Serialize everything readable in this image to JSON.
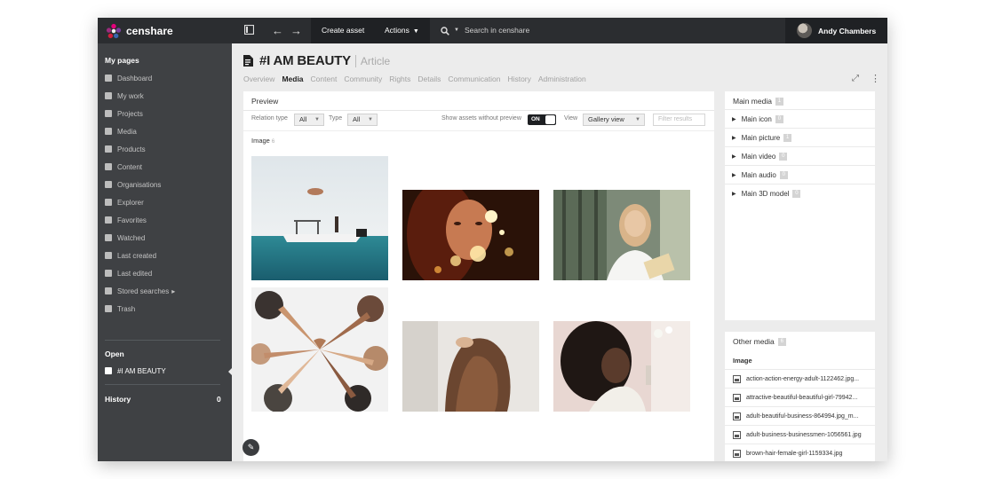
{
  "brand": {
    "name": "censhare"
  },
  "topbar": {
    "create_asset": "Create asset",
    "actions": "Actions",
    "search_placeholder": "Search in censhare",
    "user_name": "Andy Chambers"
  },
  "sidebar": {
    "my_pages_heading": "My pages",
    "items": [
      {
        "label": "Dashboard",
        "icon": "home-icon"
      },
      {
        "label": "My work",
        "icon": "inbox-icon"
      },
      {
        "label": "Projects",
        "icon": "projects-icon"
      },
      {
        "label": "Media",
        "icon": "image-icon"
      },
      {
        "label": "Products",
        "icon": "box-icon"
      },
      {
        "label": "Content",
        "icon": "document-icon"
      },
      {
        "label": "Organisations",
        "icon": "globe-icon"
      },
      {
        "label": "Explorer",
        "icon": "compass-icon"
      },
      {
        "label": "Favorites",
        "icon": "heart-icon"
      },
      {
        "label": "Watched",
        "icon": "eye-icon"
      },
      {
        "label": "Last created",
        "icon": "edit-icon"
      },
      {
        "label": "Last edited",
        "icon": "edit-icon"
      },
      {
        "label": "Stored searches",
        "icon": "search-icon"
      },
      {
        "label": "Trash",
        "icon": "trash-icon"
      }
    ],
    "open_heading": "Open",
    "open_item": "#I AM BEAUTY",
    "history_heading": "History",
    "history_count": "0"
  },
  "asset": {
    "title": "#I AM BEAUTY",
    "type": "Article",
    "tabs": [
      "Overview",
      "Media",
      "Content",
      "Community",
      "Rights",
      "Details",
      "Communication",
      "History",
      "Administration"
    ],
    "active_tab": "Media"
  },
  "preview": {
    "heading": "Preview",
    "relation_type_label": "Relation type",
    "relation_type_value": "All",
    "type_label": "Type",
    "type_value": "All",
    "show_without_preview_label": "Show assets without preview",
    "toggle_value": "ON",
    "view_label": "View",
    "view_value": "Gallery view",
    "filter_placeholder": "Filter results",
    "image_section_label": "Image",
    "image_count": "6"
  },
  "main_media": {
    "heading": "Main media",
    "count": "1",
    "rows": [
      {
        "label": "Main icon",
        "count": "0"
      },
      {
        "label": "Main picture",
        "count": "1"
      },
      {
        "label": "Main video",
        "count": "0"
      },
      {
        "label": "Main audio",
        "count": "0"
      },
      {
        "label": "Main 3D model",
        "count": "0"
      }
    ]
  },
  "other_media": {
    "heading": "Other media",
    "count": "6",
    "section": "Image",
    "files": [
      "action-action-energy-adult-1122462.jpg...",
      "attractive-beautiful-beautiful-girl-79942...",
      "adult-beautiful-business-864994.jpg_m...",
      "adult-business-businessmen-1056561.jpg",
      "brown-hair-female-girl-1159334.jpg"
    ]
  },
  "colors": {
    "topbar": "#2b2d30",
    "sidebar": "#3f4144",
    "canvas": "#ececec"
  }
}
